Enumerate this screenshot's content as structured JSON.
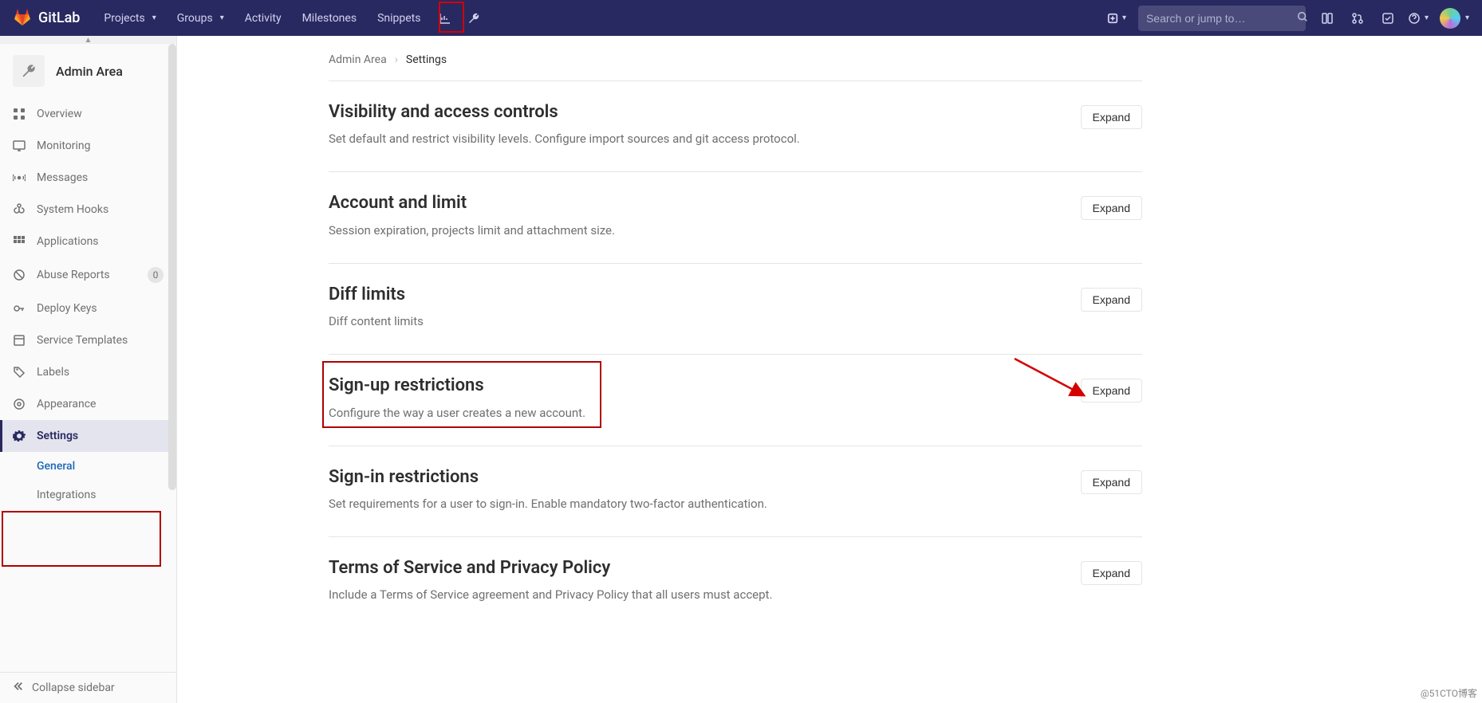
{
  "brand": {
    "name": "GitLab"
  },
  "nav": {
    "items": [
      {
        "label": "Projects",
        "caret": true
      },
      {
        "label": "Groups",
        "caret": true
      },
      {
        "label": "Activity",
        "caret": false
      },
      {
        "label": "Milestones",
        "caret": false
      },
      {
        "label": "Snippets",
        "caret": false
      }
    ]
  },
  "search": {
    "placeholder": "Search or jump to…"
  },
  "sidebar": {
    "title": "Admin Area",
    "items": [
      {
        "icon": "overview",
        "label": "Overview"
      },
      {
        "icon": "monitor",
        "label": "Monitoring"
      },
      {
        "icon": "broadcast",
        "label": "Messages"
      },
      {
        "icon": "hook",
        "label": "System Hooks"
      },
      {
        "icon": "apps",
        "label": "Applications"
      },
      {
        "icon": "abuse",
        "label": "Abuse Reports",
        "badge": "0"
      },
      {
        "icon": "key",
        "label": "Deploy Keys"
      },
      {
        "icon": "template",
        "label": "Service Templates"
      },
      {
        "icon": "labels",
        "label": "Labels"
      },
      {
        "icon": "appearance",
        "label": "Appearance"
      },
      {
        "icon": "gear",
        "label": "Settings",
        "active": true
      }
    ],
    "subitems": [
      {
        "label": "General",
        "active": true
      },
      {
        "label": "Integrations"
      }
    ],
    "collapse": "Collapse sidebar"
  },
  "breadcrumb": {
    "root": "Admin Area",
    "current": "Settings"
  },
  "sections": [
    {
      "title": "Visibility and access controls",
      "desc": "Set default and restrict visibility levels. Configure import sources and git access protocol.",
      "btn": "Expand"
    },
    {
      "title": "Account and limit",
      "desc": "Session expiration, projects limit and attachment size.",
      "btn": "Expand"
    },
    {
      "title": "Diff limits",
      "desc": "Diff content limits",
      "btn": "Expand"
    },
    {
      "title": "Sign-up restrictions",
      "desc": "Configure the way a user creates a new account.",
      "btn": "Expand"
    },
    {
      "title": "Sign-in restrictions",
      "desc": "Set requirements for a user to sign-in. Enable mandatory two-factor authentication.",
      "btn": "Expand"
    },
    {
      "title": "Terms of Service and Privacy Policy",
      "desc": "Include a Terms of Service agreement and Privacy Policy that all users must accept.",
      "btn": "Expand"
    }
  ],
  "watermark": "@51CTO博客"
}
